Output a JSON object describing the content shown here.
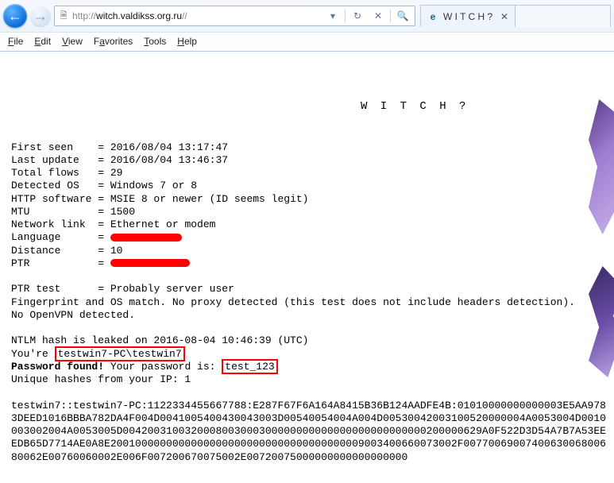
{
  "browser": {
    "url_proto": "http://",
    "url_host": "witch.valdikss.org.ru",
    "url_path": "//",
    "tab_title": "W I T C H ?",
    "menu": {
      "file": "File",
      "edit": "Edit",
      "view": "View",
      "favorites": "Favorites",
      "tools": "Tools",
      "help": "Help"
    }
  },
  "page": {
    "title": "W I T C H ?",
    "rows": {
      "first_seen": {
        "label": "First seen",
        "val": "2016/08/04 13:17:47"
      },
      "last_update": {
        "label": "Last update",
        "val": "2016/08/04 13:46:37"
      },
      "total_flows": {
        "label": "Total flows",
        "val": "29"
      },
      "detected_os": {
        "label": "Detected OS",
        "val": "Windows 7 or 8"
      },
      "http_software": {
        "label": "HTTP software",
        "val": "MSIE 8 or newer (ID seems legit)"
      },
      "mtu": {
        "label": "MTU",
        "val": "1500"
      },
      "network_link": {
        "label": "Network link",
        "val": "Ethernet or modem"
      },
      "language": {
        "label": "Language",
        "val": ""
      },
      "distance": {
        "label": "Distance",
        "val": "10"
      },
      "ptr": {
        "label": "PTR",
        "val": ""
      },
      "ptr_test": {
        "label": "PTR test",
        "val": "Probably server user"
      }
    },
    "fingerprint_line": "Fingerprint and OS match. No proxy detected (this test does not include headers detection).",
    "openvpn_line": "No OpenVPN detected.",
    "ntlm_line": "NTLM hash is leaked on 2016-08-04 10:46:39 (UTC)",
    "youre_prefix": "You're ",
    "youre_value": "testwin7-PC\\testwin7",
    "pwd_prefix": "Password found!",
    "pwd_mid": " Your password is: ",
    "pwd_value": "test_123",
    "unique_line": "Unique hashes from your IP: 1",
    "hash_line": "testwin7::testwin7-PC:1122334455667788:E287F67F6A164A8415B36B124AADFE4B:01010000000000003E5AA9783DEED1016BBBA782DA4F004D0041005400430043003D00540054004A004D00530042003100520000004A0053004D0010003002004A0053005D0042003100320008003000300000000000000000000000000200000629A0F522D3D54A7B7A53EEEDB65D7714AE0A8E20010000000000000000000000000000000000009003400660073002F0077006900740063006800680062E00760060002E006F007200670075002E00720075000000000000000000"
  }
}
